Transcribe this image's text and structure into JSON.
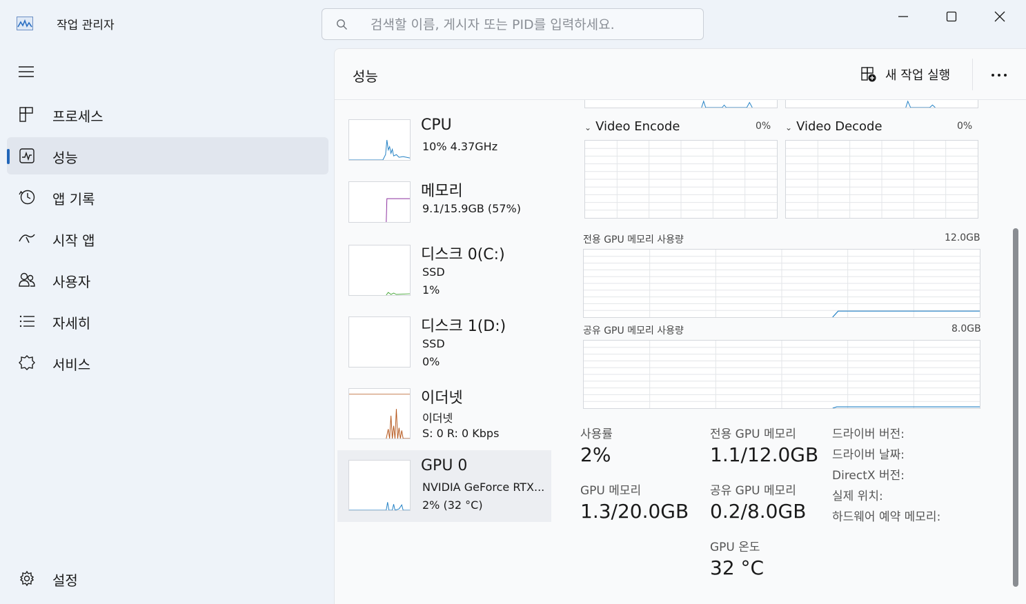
{
  "app": {
    "title": "작업 관리자",
    "search_placeholder": "검색할 이름, 게시자 또는 PID를 입력하세요."
  },
  "nav": {
    "items": [
      {
        "label": "프로세스",
        "icon": "processes-icon"
      },
      {
        "label": "성능",
        "icon": "performance-icon",
        "active": true
      },
      {
        "label": "앱 기록",
        "icon": "history-icon"
      },
      {
        "label": "시작 앱",
        "icon": "startup-icon"
      },
      {
        "label": "사용자",
        "icon": "users-icon"
      },
      {
        "label": "자세히",
        "icon": "details-icon"
      },
      {
        "label": "서비스",
        "icon": "services-icon"
      }
    ],
    "settings": "설정"
  },
  "header": {
    "title": "성능",
    "run_new_task": "새 작업 실행"
  },
  "devices": [
    {
      "name": "CPU",
      "line1": "10%  4.37GHz",
      "line2": ""
    },
    {
      "name": "메모리",
      "line1": "9.1/15.9GB (57%)",
      "line2": ""
    },
    {
      "name": "디스크 0(C:)",
      "line1": "SSD",
      "line2": "1%"
    },
    {
      "name": "디스크 1(D:)",
      "line1": "SSD",
      "line2": "0%"
    },
    {
      "name": "이더넷",
      "line1": "이더넷",
      "line2": "S: 0  R: 0 Kbps"
    },
    {
      "name": "GPU 0",
      "line1": "NVIDIA GeForce RTX...",
      "line2": "2% (32 °C)",
      "active": true
    }
  ],
  "gpu": {
    "video_encode": {
      "label": "Video Encode",
      "value": "0%"
    },
    "video_decode": {
      "label": "Video Decode",
      "value": "0%"
    },
    "dedicated_mem_graph": {
      "label": "전용 GPU 메모리 사용량",
      "max": "12.0GB"
    },
    "shared_mem_graph": {
      "label": "공유 GPU 메모리 사용량",
      "max": "8.0GB"
    },
    "stats": {
      "usage_label": "사용률",
      "usage_value": "2%",
      "dedicated_label": "전용 GPU 메모리",
      "dedicated_value": "1.1/12.0GB",
      "gpu_mem_label": "GPU 메모리",
      "gpu_mem_value": "1.3/20.0GB",
      "shared_label": "공유 GPU 메모리",
      "shared_value": "0.2/8.0GB",
      "temp_label": "GPU 온도",
      "temp_value": "32 °C"
    },
    "info": {
      "driver_version": "드라이버 버전:",
      "driver_date": "드라이버 날짜:",
      "directx": "DirectX 버전:",
      "location": "실제 위치:",
      "hw_reserved": "하드웨어 예약 메모리:"
    }
  },
  "colors": {
    "accent": "#2166b8",
    "cpu": "#1f7fc4",
    "memory": "#8b2e9e",
    "disk": "#4aa83c",
    "ethernet": "#b5561b",
    "gpu": "#1f7fc4"
  }
}
